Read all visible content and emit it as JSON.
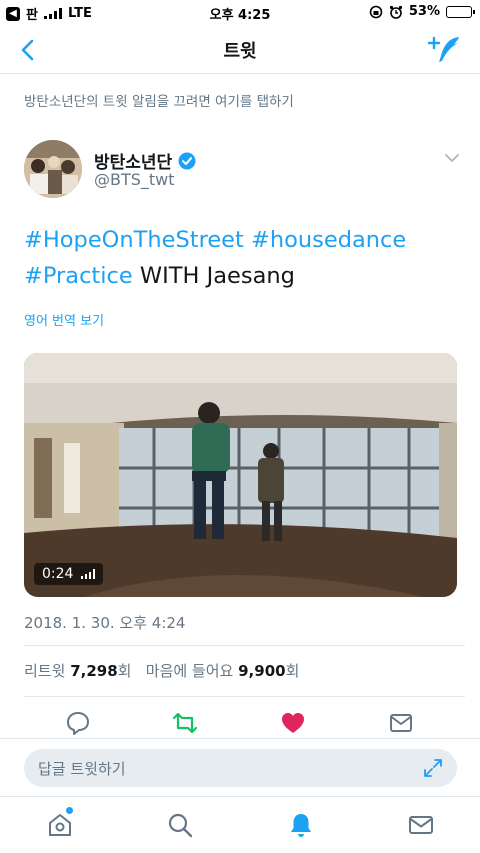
{
  "status": {
    "carrier": "판",
    "network": "LTE",
    "time": "오후 4:25",
    "battery": "53%",
    "battery_level": 0.53
  },
  "nav": {
    "title": "트윗"
  },
  "notification": {
    "text": "방탄소년단의 트윗 알림을 끄려면 여기를 탭하기"
  },
  "author": {
    "name": "방탄소년단",
    "handle": "@BTS_twt"
  },
  "tweet": {
    "tag1": "#HopeOnTheStreet",
    "tag2": "#housedance",
    "tag3": "#Practice",
    "text_rest": " WITH Jaesang",
    "translate": "영어 번역 보기",
    "media_duration": "0:24",
    "date": "2018. 1. 30. 오후 4:24"
  },
  "stats": {
    "retweets_label": "리트윗",
    "retweets_count": "7,298",
    "retweets_suffix": "회",
    "likes_label": "마음에 들어요",
    "likes_count": "9,900",
    "likes_suffix": "회"
  },
  "reply": {
    "placeholder": "답글 트윗하기"
  },
  "colors": {
    "accent": "#1da1f2",
    "retweet": "#17bf63",
    "like": "#e0245e",
    "muted": "#657786"
  }
}
